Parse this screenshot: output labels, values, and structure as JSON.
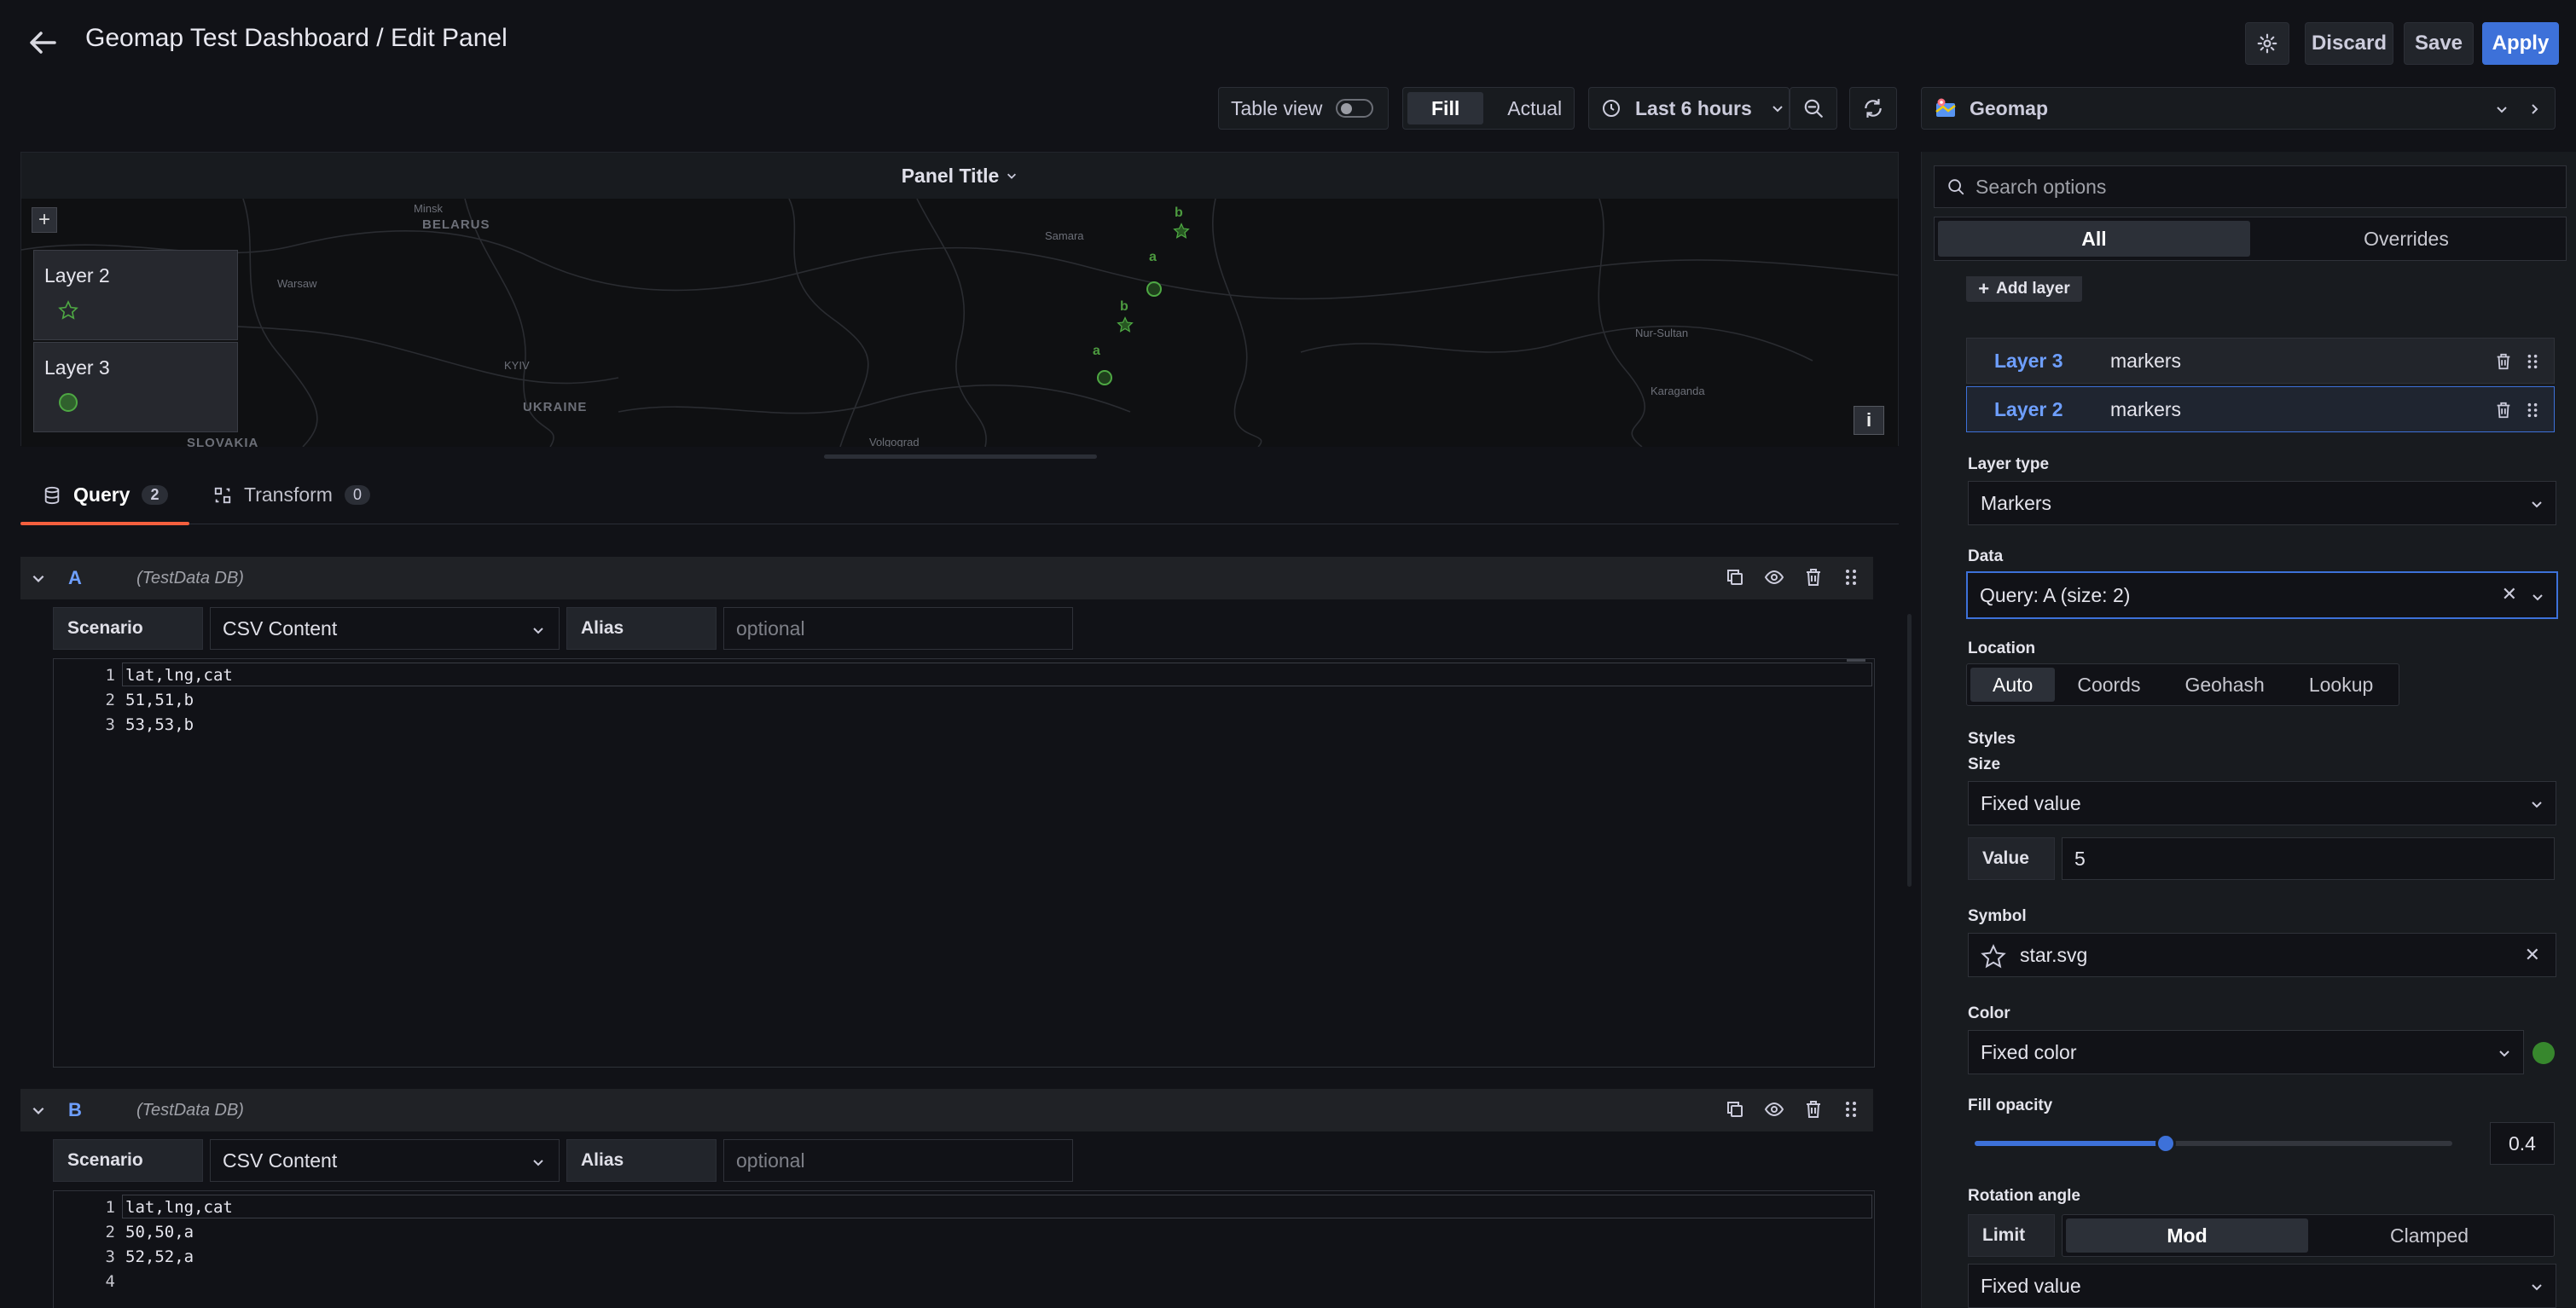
{
  "header": {
    "title": "Geomap Test Dashboard / Edit Panel",
    "discard_label": "Discard",
    "save_label": "Save",
    "apply_label": "Apply"
  },
  "toolbar": {
    "table_view_label": "Table view",
    "table_view_on": false,
    "fill_label": "Fill",
    "actual_label": "Actual",
    "time_range": "Last 6 hours"
  },
  "panel": {
    "title": "Panel Title",
    "map_labels": [
      "BELARUS",
      "Minsk",
      "Warsaw",
      "KYIV",
      "UKRAINE",
      "SLOVAKIA",
      "Samara",
      "Volgograd",
      "Nur-Sultan",
      "Karaganda"
    ],
    "legend": [
      {
        "name": "Layer 2",
        "symbol": "star"
      },
      {
        "name": "Layer 3",
        "symbol": "circle"
      }
    ],
    "markers": [
      {
        "label": "b",
        "symbol": "star"
      },
      {
        "label": "a",
        "symbol": "circle"
      },
      {
        "label": "b",
        "symbol": "star"
      },
      {
        "label": "a",
        "symbol": "circle"
      }
    ],
    "zoom_in": "+",
    "info_label": "i"
  },
  "tabs": {
    "query_label": "Query",
    "query_count": "2",
    "transform_label": "Transform",
    "transform_count": "0"
  },
  "queries": [
    {
      "letter": "A",
      "datasource": "(TestData DB)",
      "scenario_label": "Scenario",
      "scenario": "CSV Content",
      "alias_label": "Alias",
      "alias_placeholder": "optional",
      "lines": [
        "lat,lng,cat",
        "51,51,b",
        "53,53,b"
      ],
      "line_numbers": [
        "1",
        "2",
        "3"
      ]
    },
    {
      "letter": "B",
      "datasource": "(TestData DB)",
      "scenario_label": "Scenario",
      "scenario": "CSV Content",
      "alias_label": "Alias",
      "alias_placeholder": "optional",
      "lines": [
        "lat,lng,cat",
        "50,50,a",
        "52,52,a",
        ""
      ],
      "line_numbers": [
        "1",
        "2",
        "3",
        "4"
      ]
    }
  ],
  "options": {
    "visualization": "Geomap",
    "search_placeholder": "Search options",
    "tab_all": "All",
    "tab_overrides": "Overrides",
    "add_layer_label": "Add layer",
    "layers": [
      {
        "name": "Layer 3",
        "type": "markers",
        "selected": false
      },
      {
        "name": "Layer 2",
        "type": "markers",
        "selected": true
      }
    ],
    "layer_type_label": "Layer type",
    "layer_type": "Markers",
    "data_label": "Data",
    "data_value": "Query: A (size: 2)",
    "location_label": "Location",
    "location_options": [
      "Auto",
      "Coords",
      "Geohash",
      "Lookup"
    ],
    "location_selected": "Auto",
    "styles_label": "Styles",
    "size_label": "Size",
    "size_mode": "Fixed value",
    "value_label": "Value",
    "size_value": "5",
    "symbol_label": "Symbol",
    "symbol_value": "star.svg",
    "color_label": "Color",
    "color_mode": "Fixed color",
    "color_swatch": "#37872d",
    "fill_opacity_label": "Fill opacity",
    "fill_opacity": "0.4",
    "fill_opacity_value": 0.4,
    "rotation_label": "Rotation angle",
    "limit_label": "Limit",
    "limit_options": [
      "Mod",
      "Clamped"
    ],
    "limit_selected": "Mod",
    "rotation_mode": "Fixed value"
  },
  "colors": {
    "accent": "#3d71d9",
    "tab_underline": "#f55f3e",
    "marker_green": "#37872d",
    "link_blue": "#6e9fff"
  }
}
